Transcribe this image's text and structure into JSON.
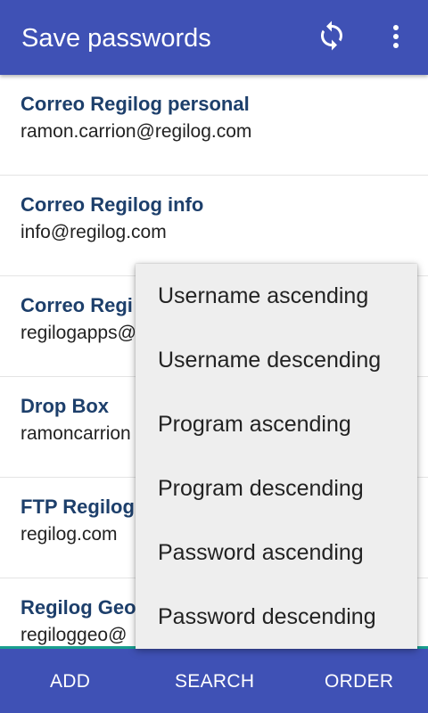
{
  "app_bar": {
    "title": "Save passwords",
    "icons": [
      "sync-icon",
      "more-vert-icon"
    ]
  },
  "entries": [
    {
      "program": "Correo Regilog personal",
      "username": "ramon.carrion@regilog.com"
    },
    {
      "program": "Correo Regilog info",
      "username": "info@regilog.com"
    },
    {
      "program": "Correo Regi",
      "username": "regilogapps@"
    },
    {
      "program": "Drop Box",
      "username": "ramoncarrion"
    },
    {
      "program": "FTP Regilog",
      "username": "regilog.com"
    },
    {
      "program": "Regilog Geo",
      "username": "regiloggeo@"
    }
  ],
  "order_menu": [
    "Username ascending",
    "Username descending",
    "Program ascending",
    "Program descending",
    "Password ascending",
    "Password descending"
  ],
  "bottom_bar": {
    "add_label": "ADD",
    "search_label": "SEARCH",
    "order_label": "ORDER"
  },
  "colors": {
    "primary": "#3f51b5",
    "accent": "#199f8e",
    "entry_title": "#1d3f6b"
  }
}
